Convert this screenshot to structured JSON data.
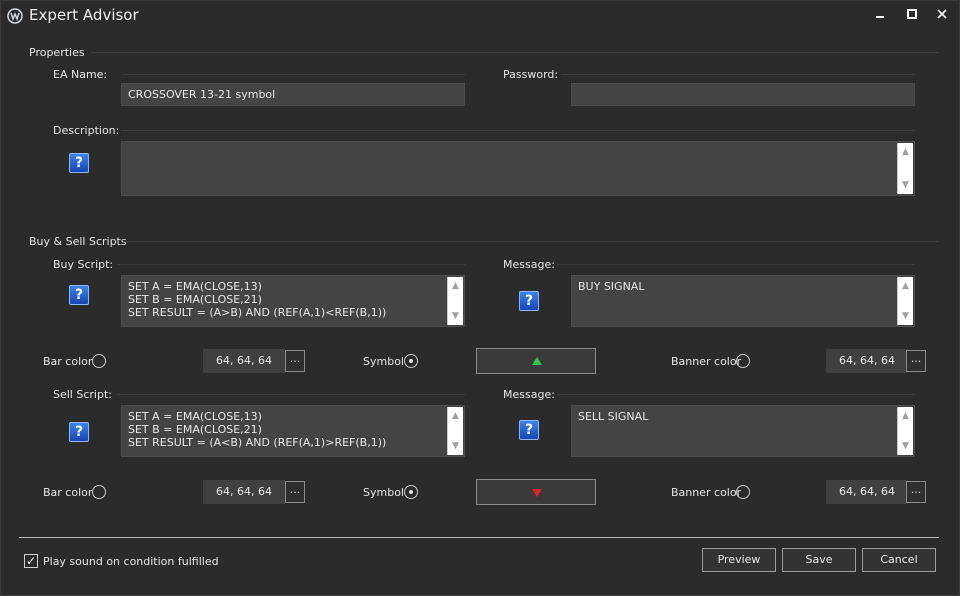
{
  "window": {
    "title": "Expert Advisor",
    "controls": {
      "minimize": "▁",
      "maximize": "▢",
      "close": "✕"
    }
  },
  "properties": {
    "section_label": "Properties",
    "ea_name_label": "EA Name:",
    "ea_name_value": "CROSSOVER 13-21 symbol",
    "password_label": "Password:",
    "password_value": "",
    "description_label": "Description:",
    "description_value": ""
  },
  "scripts": {
    "section_label": "Buy & Sell Scripts",
    "buy": {
      "script_label": "Buy Script:",
      "script_value": "SET A = EMA(CLOSE,13)\nSET B = EMA(CLOSE,21)\nSET RESULT = (A>B) AND (REF(A,1)<REF(B,1))",
      "message_label": "Message:",
      "message_value": "BUY SIGNAL",
      "bar_color_label": "Bar color",
      "bar_color_value": "64, 64, 64",
      "symbol_label": "Symbol",
      "banner_color_label": "Banner color",
      "banner_color_value": "64, 64, 64",
      "symbol_color": "#2ec84a"
    },
    "sell": {
      "script_label": "Sell Script:",
      "script_value": "SET A = EMA(CLOSE,13)\nSET B = EMA(CLOSE,21)\nSET RESULT = (A<B) AND (REF(A,1)>REF(B,1))",
      "message_label": "Message:",
      "message_value": "SELL SIGNAL",
      "bar_color_label": "Bar color",
      "bar_color_value": "64, 64, 64",
      "symbol_label": "Symbol",
      "banner_color_label": "Banner color",
      "banner_color_value": "64, 64, 64",
      "symbol_color": "#e02424"
    },
    "ellipsis": "..."
  },
  "icons": {
    "help": "?",
    "scroll_up": "▲",
    "scroll_down": "▼",
    "check": "✓"
  },
  "footer": {
    "play_sound_label": "Play sound on condition fulfilled",
    "play_sound_checked": true,
    "preview_label": "Preview",
    "save_label": "Save",
    "cancel_label": "Cancel"
  }
}
